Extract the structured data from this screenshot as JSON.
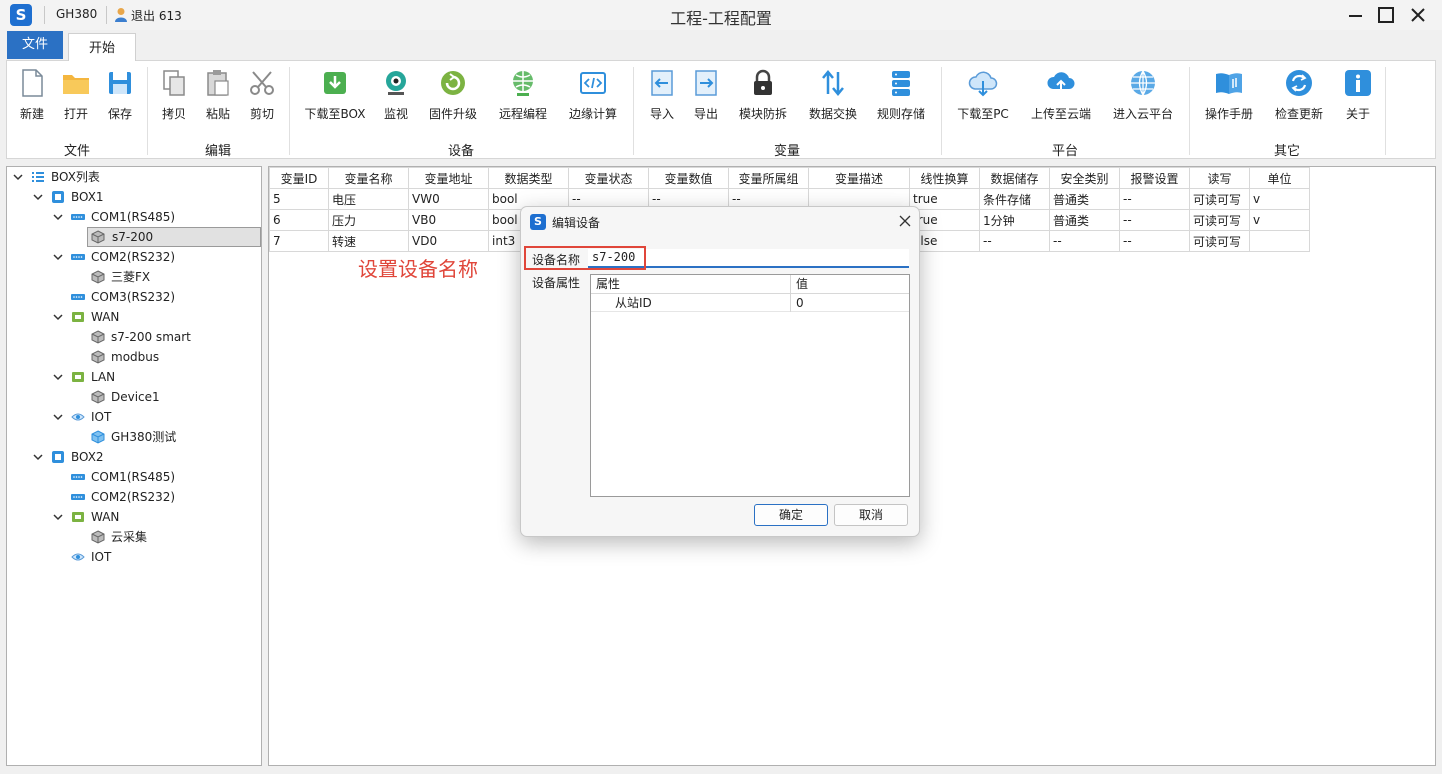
{
  "titlebar": {
    "logo_letter": "S",
    "project": "GH380",
    "user": "退出 613",
    "window_title": "工程-工程配置"
  },
  "tabs": {
    "file": "文件",
    "start": "开始"
  },
  "ribbon": {
    "groups": {
      "file": "文件",
      "edit": "编辑",
      "device": "设备",
      "variable": "变量",
      "platform": "平台",
      "other": "其它"
    },
    "buttons": {
      "new": "新建",
      "open": "打开",
      "save": "保存",
      "copy": "拷贝",
      "paste": "粘贴",
      "cut": "剪切",
      "download_box": "下载至BOX",
      "monitor": "监视",
      "firmware": "固件升级",
      "remote": "远程编程",
      "edge": "边缘计算",
      "import": "导入",
      "export": "导出",
      "module": "模块防拆",
      "exchange": "数据交换",
      "rules": "规则存储",
      "download_pc": "下载至PC",
      "upload_cloud": "上传至云端",
      "cloud_platform": "进入云平台",
      "manual": "操作手册",
      "update": "检查更新",
      "about": "关于"
    }
  },
  "tree": {
    "root": "BOX列表",
    "box1": "BOX1",
    "box1_com1": "COM1(RS485)",
    "box1_com1_dev": "s7-200",
    "box1_com2": "COM2(RS232)",
    "box1_com2_dev": "三菱FX",
    "box1_com3": "COM3(RS232)",
    "box1_wan": "WAN",
    "box1_wan_dev1": "s7-200 smart",
    "box1_wan_dev2": "modbus",
    "box1_lan": "LAN",
    "box1_lan_dev": "Device1",
    "box1_iot": "IOT",
    "box1_iot_dev": "GH380测试",
    "box2": "BOX2",
    "box2_com1": "COM1(RS485)",
    "box2_com2": "COM2(RS232)",
    "box2_wan": "WAN",
    "box2_wan_dev": "云采集",
    "box2_iot": "IOT"
  },
  "grid": {
    "headers": [
      "变量ID",
      "变量名称",
      "变量地址",
      "数据类型",
      "变量状态",
      "变量数值",
      "变量所属组",
      "变量描述",
      "线性换算",
      "数据储存",
      "安全类别",
      "报警设置",
      "读写",
      "单位"
    ],
    "rows": [
      [
        "5",
        "电压",
        "VW0",
        "bool",
        "--",
        "--",
        "--",
        "",
        "true",
        "条件存储",
        "普通类",
        "--",
        "可读可写",
        "v"
      ],
      [
        "6",
        "压力",
        "VB0",
        "bool",
        "",
        "",
        "",
        "",
        "true",
        "1分钟",
        "普通类",
        "--",
        "可读可写",
        "v"
      ],
      [
        "7",
        "转速",
        "VD0",
        "int3",
        "",
        "",
        "",
        "",
        "alse",
        "--",
        "--",
        "--",
        "可读可写",
        ""
      ]
    ]
  },
  "annotation": "设置设备名称",
  "dialog": {
    "title": "编辑设备",
    "name_label": "设备名称",
    "name_value": "s7-200",
    "props_label": "设备属性",
    "prop_header_attr": "属性",
    "prop_header_value": "值",
    "prop_row_attr": "从站ID",
    "prop_row_value": "0",
    "ok": "确定",
    "cancel": "取消"
  },
  "colors": {
    "accent": "#2b71c4",
    "annotation": "#e0463a",
    "icon_green": "#4caf50",
    "icon_blue": "#2f8fdc"
  }
}
